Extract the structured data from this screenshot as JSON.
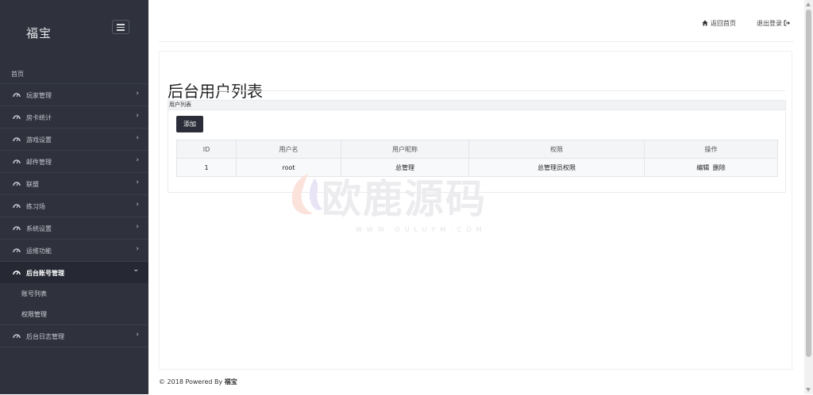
{
  "sidebar": {
    "brand": "福宝",
    "home_label": "首页",
    "items": [
      {
        "label": "玩家管理",
        "icon": "dashboard-icon",
        "expanded": false
      },
      {
        "label": "房卡统计",
        "icon": "dashboard-icon",
        "expanded": false
      },
      {
        "label": "游戏设置",
        "icon": "dashboard-icon",
        "expanded": false
      },
      {
        "label": "邮件管理",
        "icon": "dashboard-icon",
        "expanded": false
      },
      {
        "label": "联盟",
        "icon": "dashboard-icon",
        "expanded": false
      },
      {
        "label": "练习场",
        "icon": "dashboard-icon",
        "expanded": false
      },
      {
        "label": "系统设置",
        "icon": "dashboard-icon",
        "expanded": false
      },
      {
        "label": "运维功能",
        "icon": "dashboard-icon",
        "expanded": false
      },
      {
        "label": "后台账号管理",
        "icon": "dashboard-icon",
        "expanded": true
      },
      {
        "label": "后台日志管理",
        "icon": "dashboard-icon",
        "expanded": false
      }
    ],
    "sub_items": [
      {
        "label": "账号列表"
      },
      {
        "label": "权限管理"
      }
    ],
    "chevron_right": "›",
    "chevron_down": "⌄"
  },
  "header": {
    "home_link": "返回首页",
    "logout_link": "退出登录"
  },
  "main": {
    "title": "后台用户列表",
    "panel_title": "用户列表",
    "add_button": "添加",
    "table": {
      "columns": [
        "ID",
        "用户名",
        "用户昵称",
        "权限",
        "操作"
      ],
      "rows": [
        {
          "id": "1",
          "username": "root",
          "nickname": "总管理",
          "permission": "总管理员权限",
          "edit": "编辑",
          "delete": "删除"
        }
      ]
    }
  },
  "watermark": {
    "text": "欧鹿源码",
    "sub": "WWW.OULUYM.COM"
  },
  "footer": {
    "prefix": "© 2018 Powered By ",
    "brand": "福宝"
  },
  "colors": {
    "sidebar_bg": "#2f323d",
    "sidebar_active_bg": "#262933",
    "button_bg": "#2b2e38"
  }
}
